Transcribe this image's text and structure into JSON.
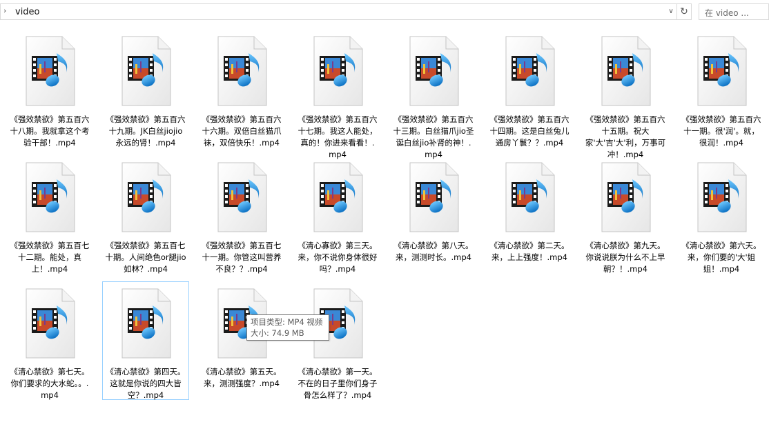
{
  "address": {
    "path": "video"
  },
  "search": {
    "placeholder": "在 video ..."
  },
  "files": [
    {
      "name": "《强效禁欲》第五百六十八期。我就拿这个考验干部！.mp4"
    },
    {
      "name": "《强效禁欲》第五百六十九期。JK白丝jiojio永远的肾！.mp4"
    },
    {
      "name": "《强效禁欲》第五百六十六期。双倍白丝猫爪袜，双倍快乐！.mp4"
    },
    {
      "name": "《强效禁欲》第五百六十七期。我这人能处，真的！你进来看看！.mp4"
    },
    {
      "name": "《强效禁欲》第五百六十三期。白丝猫爪jio圣诞白丝jio补肾的神！.mp4"
    },
    {
      "name": "《强效禁欲》第五百六十四期。这是白丝兔儿通房丫鬟？？.mp4"
    },
    {
      "name": "《强效禁欲》第五百六十五期。祝大家'大'吉'大'利，万事可冲！.mp4"
    },
    {
      "name": "《强效禁欲》第五百六十一期。很'润'。就，很润！.mp4"
    },
    {
      "name": "《强效禁欲》第五百七十二期。能处，真上！.mp4"
    },
    {
      "name": "《强效禁欲》第五百七十期。人间绝色or腿jio如林？.mp4"
    },
    {
      "name": "《强效禁欲》第五百七十一期。你管这叫营养不良？？.mp4"
    },
    {
      "name": "《清心寡欲》第三天。来，你不说你身体很好吗？.mp4"
    },
    {
      "name": "《清心禁欲》第八天。来，测测时长。.mp4"
    },
    {
      "name": "《清心禁欲》第二天。来，上上强度！.mp4"
    },
    {
      "name": "《清心禁欲》第九天。你说说朕为什么不上早朝？！.mp4"
    },
    {
      "name": "《清心禁欲》第六天。来，你们要的'大'姐姐！.mp4"
    },
    {
      "name": "《清心禁欲》第七天。你们要求的大水蛇。。.mp4"
    },
    {
      "name": "《清心禁欲》第四天。这就是你说的四大皆空？.mp4"
    },
    {
      "name": "《清心禁欲》第五天。来，测测强度？.mp4"
    },
    {
      "name": "《清心禁欲》第一天。不在的日子里你们身子骨怎么样了？.mp4"
    }
  ],
  "tooltip": {
    "type_line": "项目类型: MP4 视频",
    "size_line": "大小: 74.9 MB"
  }
}
